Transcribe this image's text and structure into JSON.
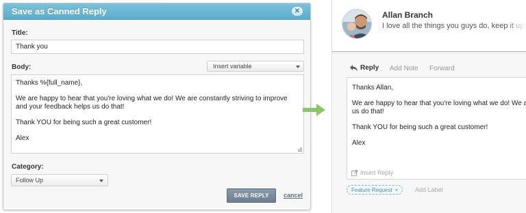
{
  "modal": {
    "title": "Save as Canned Reply",
    "close_glyph": "✕",
    "title_label": "Title:",
    "title_value": "Thank you",
    "body_label": "Body:",
    "insert_variable": "Insert variable",
    "body_lines": [
      "Thanks %{full_name},",
      "We are happy to hear that you're loving what we do! We are constantly striving to improve and your feedback helps us do that!",
      "Thank YOU for being such a great customer!",
      "Alex"
    ],
    "category_label": "Category:",
    "category_value": "Follow Up",
    "save_button": "SAVE REPLY",
    "cancel_link": "cancel"
  },
  "arrow": {
    "color": "#8cc56b"
  },
  "conversation": {
    "sender": "Allan Branch",
    "snippet": "I love all the things you guys do, keep it up",
    "tabs": {
      "reply": "Reply",
      "add_note": "Add Note",
      "forward": "Forward"
    },
    "reply_lines": [
      "Thanks Allan,",
      "We are happy to hear that you're loving what we do! We a",
      "us do that!",
      "Thank YOU for being such a great customer!",
      "Alex"
    ],
    "insert_reply": "Insert Reply",
    "label_tag": "Feature Request",
    "label_remove": "×",
    "add_label": "Add Label"
  },
  "colors": {
    "header_blue": "#5aabc9",
    "button_gray": "#6b7d8f",
    "tag_blue": "#4a90ad"
  },
  "icons": [
    "close-icon",
    "caret-down-icon",
    "resize-handle-icon",
    "arrow-right-icon",
    "reply-arrow-icon",
    "insert-reply-icon",
    "remove-tag-icon",
    "avatar-image"
  ]
}
